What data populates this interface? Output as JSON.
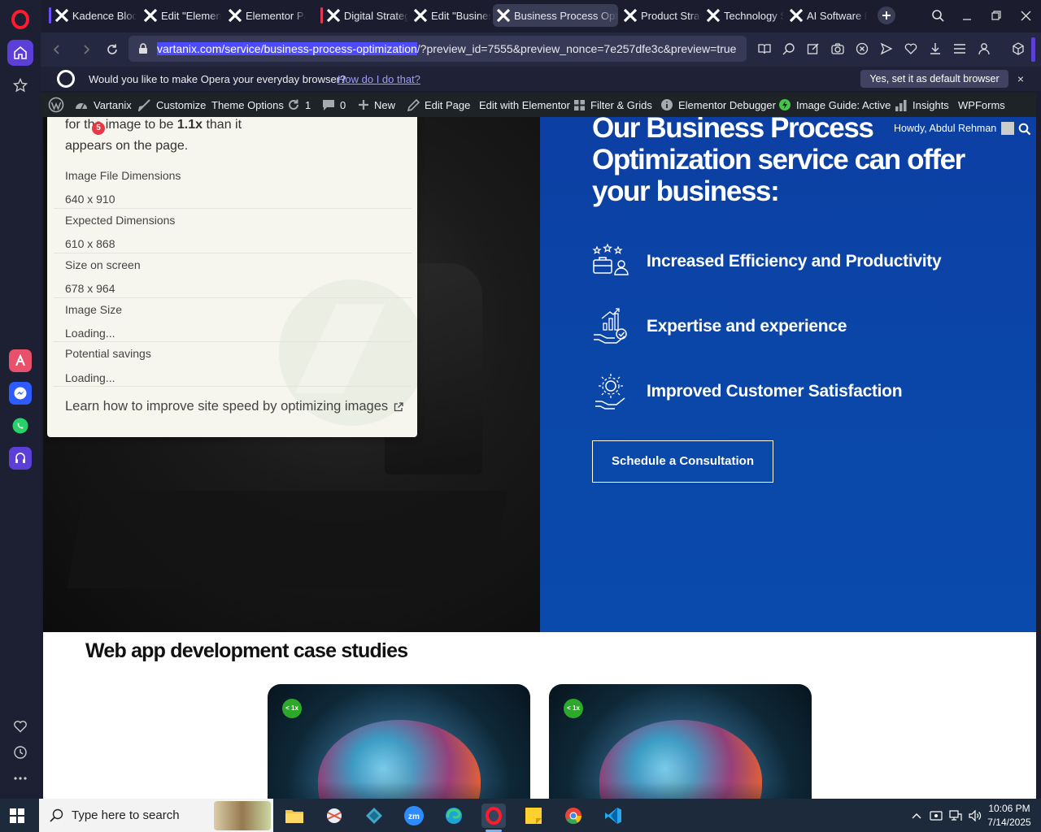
{
  "browser": {
    "tabs": [
      {
        "label": "Kadence Block",
        "stripe": "#6b4fff",
        "active": false
      },
      {
        "label": "Edit \"Elemento",
        "stripe": "",
        "active": false
      },
      {
        "label": "Elementor Pa",
        "stripe": "",
        "active": false
      },
      {
        "label": "Digital Strateg",
        "stripe": "#e03a55",
        "active": false
      },
      {
        "label": "Edit \"Business",
        "stripe": "",
        "active": false
      },
      {
        "label": "Business Process Optim",
        "stripe": "",
        "active": true
      },
      {
        "label": "Product Strate",
        "stripe": "",
        "active": false
      },
      {
        "label": "Technology St",
        "stripe": "",
        "active": false
      },
      {
        "label": "AI Software D",
        "stripe": "",
        "active": false
      }
    ],
    "url_highlighted": "vartanix.com/service/business-process-optimization",
    "url_rest": "/?preview_id=7555&preview_nonce=7e257dfe3c&preview=true",
    "prompt": {
      "text": "Would you like to make Opera your everyday browser?",
      "link": "How do I do that?",
      "button": "Yes, set it as default browser",
      "close": "×"
    }
  },
  "wp_admin_bar": {
    "site": "Vartanix",
    "customize": "Customize",
    "theme_options": "Theme Options",
    "updates": "1",
    "comments": "0",
    "new": "New",
    "edit_page": "Edit Page",
    "edit_elementor": "Edit with Elementor",
    "filter_grids": "Filter & Grids",
    "debugger": "Elementor Debugger",
    "image_guide": "Image Guide: Active",
    "insights": "Insights",
    "wpforms": "WPForms",
    "howdy": "Howdy, Abdul Rehman"
  },
  "image_guide": {
    "lead_part1": "for the image to be ",
    "lead_bold": "1.1x",
    "lead_part2": " than it",
    "lead_line2": "appears on the page.",
    "badge": "5",
    "rows": [
      {
        "label": "Image File Dimensions",
        "value": "640 x 910"
      },
      {
        "label": "Expected Dimensions",
        "value": "610 x 868"
      },
      {
        "label": "Size on screen",
        "value": "678 x 964"
      },
      {
        "label": "Image Size",
        "value": "Loading..."
      },
      {
        "label": "Potential savings",
        "value": "Loading..."
      }
    ],
    "link": "Learn how to improve site speed by optimizing images"
  },
  "hero": {
    "title": "Our Business Process Optimization service can offer your business:",
    "benefits": [
      {
        "text": "Increased Efficiency and Productivity",
        "icon": "productivity-icon"
      },
      {
        "text": "Expertise and experience",
        "icon": "expertise-icon"
      },
      {
        "text": "Improved Customer Satisfaction",
        "icon": "satisfaction-icon"
      }
    ],
    "cta": "Schedule a Consultation"
  },
  "case_studies": {
    "title": "Web app development case studies",
    "badge": "< 1x"
  },
  "taskbar": {
    "search_placeholder": "Type here to search",
    "time": "10:06 PM",
    "date": "7/14/2025"
  },
  "colors": {
    "hero_blue": "#0a47a8",
    "opera_red": "#ff1b2d",
    "wp_bar": "#1d2327",
    "accent_purple": "#5b3fd6"
  }
}
